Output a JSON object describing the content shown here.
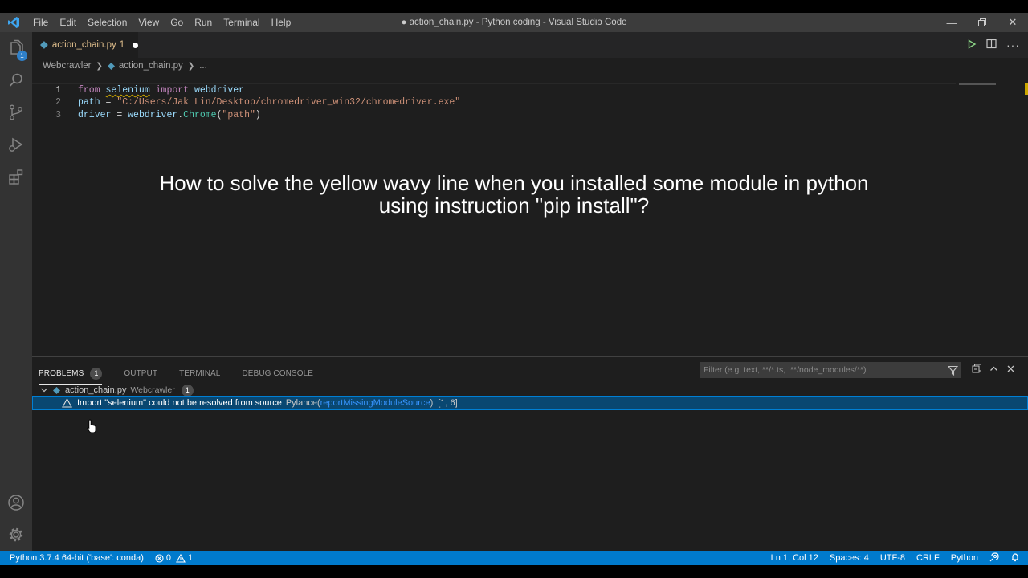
{
  "window": {
    "title": "● action_chain.py - Python coding - Visual Studio Code",
    "menu": [
      "File",
      "Edit",
      "Selection",
      "View",
      "Go",
      "Run",
      "Terminal",
      "Help"
    ]
  },
  "activity_bar": {
    "explorer_badge": "1"
  },
  "tab": {
    "file_name": "action_chain.py",
    "problem_count": "1"
  },
  "breadcrumb": {
    "folder": "Webcrawler",
    "file": "action_chain.py",
    "symbol": "..."
  },
  "editor": {
    "lines": [
      {
        "number": "1",
        "tokens": [
          {
            "t": "from",
            "c": "kw"
          },
          {
            "t": " ",
            "c": "pl"
          },
          {
            "t": "selenium",
            "c": "var",
            "squiggle": true
          },
          {
            "t": " ",
            "c": "pl"
          },
          {
            "t": "import",
            "c": "kw"
          },
          {
            "t": " ",
            "c": "pl"
          },
          {
            "t": "webdriver",
            "c": "var"
          }
        ]
      },
      {
        "number": "2",
        "tokens": [
          {
            "t": "path",
            "c": "var"
          },
          {
            "t": " = ",
            "c": "pl"
          },
          {
            "t": "\"C:/Users/Jak Lin/Desktop/chromedriver_win32/chromedriver.exe\"",
            "c": "str"
          }
        ]
      },
      {
        "number": "3",
        "tokens": [
          {
            "t": "driver",
            "c": "var"
          },
          {
            "t": " = ",
            "c": "pl"
          },
          {
            "t": "webdriver",
            "c": "var"
          },
          {
            "t": ".",
            "c": "pl"
          },
          {
            "t": "Chrome",
            "c": "cls"
          },
          {
            "t": "(",
            "c": "pl"
          },
          {
            "t": "\"path\"",
            "c": "str"
          },
          {
            "t": ")",
            "c": "pl"
          }
        ]
      }
    ]
  },
  "overlay": {
    "line1": "How to solve the yellow wavy line when you installed some module in python",
    "line2": "using instruction \"pip install\"?"
  },
  "panel": {
    "tabs": [
      {
        "label": "PROBLEMS",
        "badge": "1",
        "active": true
      },
      {
        "label": "OUTPUT"
      },
      {
        "label": "TERMINAL"
      },
      {
        "label": "DEBUG CONSOLE"
      }
    ],
    "filter_placeholder": "Filter (e.g. text, **/*.ts, !**/node_modules/**)",
    "problem_file": {
      "name": "action_chain.py",
      "folder": "Webcrawler",
      "count": "1"
    },
    "problem": {
      "message": "Import \"selenium\" could not be resolved from source",
      "source": "Pylance(",
      "code": "reportMissingModuleSource",
      "source_close": ")",
      "position": "[1, 6]"
    }
  },
  "status_bar": {
    "interpreter": "Python 3.7.4 64-bit ('base': conda)",
    "errors": "0",
    "warnings": "1",
    "cursor": "Ln 1, Col 12",
    "spaces": "Spaces: 4",
    "encoding": "UTF-8",
    "eol": "CRLF",
    "language": "Python"
  },
  "colors": {
    "accent": "#007acc",
    "warning": "#cca700",
    "selection": "#094771"
  }
}
